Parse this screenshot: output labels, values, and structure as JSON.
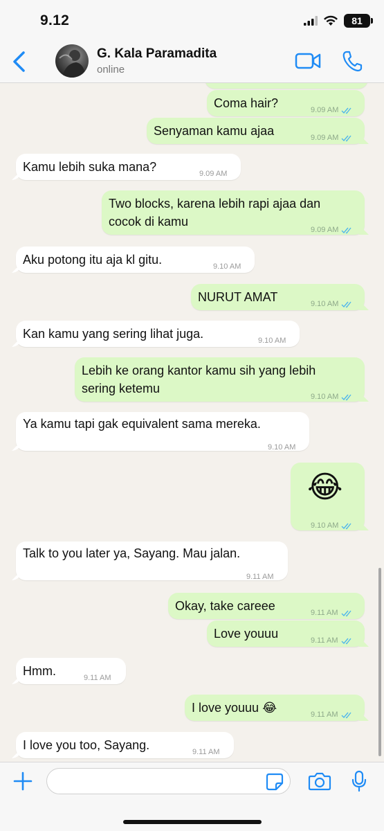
{
  "status_bar": {
    "time": "9.12",
    "battery": "81"
  },
  "header": {
    "contact_name": "G. Kala Paramadita",
    "contact_status": "online"
  },
  "messages": [
    {
      "dir": "out",
      "text": "Coma hair?",
      "time": "9.09 AM"
    },
    {
      "dir": "out",
      "text": "Senyaman kamu ajaa",
      "time": "9.09 AM"
    },
    {
      "dir": "in",
      "text": "Kamu lebih suka mana?",
      "time": "9.09 AM"
    },
    {
      "dir": "out",
      "text": "Two blocks, karena lebih rapi ajaa dan\ncocok di kamu",
      "time": "9.09 AM"
    },
    {
      "dir": "in",
      "text": "Aku potong itu aja kl gitu.",
      "time": "9.10 AM"
    },
    {
      "dir": "out",
      "text": "NURUT AMAT",
      "time": "9.10 AM"
    },
    {
      "dir": "in",
      "text": "Kan kamu yang sering lihat juga.",
      "time": "9.10 AM"
    },
    {
      "dir": "out",
      "text": "Lebih ke orang kantor kamu sih yang lebih\nsering ketemu",
      "time": "9.10 AM"
    },
    {
      "dir": "in",
      "text": "Ya kamu tapi gak equivalent sama mereka.",
      "time": "9.10 AM"
    },
    {
      "dir": "out",
      "text": "😂",
      "time": "9.10 AM"
    },
    {
      "dir": "in",
      "text": "Talk to you later ya, Sayang. Mau jalan.",
      "time": "9.11 AM"
    },
    {
      "dir": "out",
      "text": "Okay, take careee",
      "time": "9.11 AM"
    },
    {
      "dir": "out",
      "text": "Love youuu",
      "time": "9.11 AM"
    },
    {
      "dir": "in",
      "text": "Hmm.",
      "time": "9.11 AM"
    },
    {
      "dir": "out",
      "text": "I love youuu 😂",
      "time": "9.11 AM"
    },
    {
      "dir": "in",
      "text": "I love you too, Sayang.",
      "time": "9.11 AM"
    }
  ],
  "input": {
    "placeholder": ""
  },
  "icons": {
    "back": "chevron-left-icon",
    "video": "video-camera-icon",
    "phone": "phone-icon",
    "plus": "plus-icon",
    "sticker": "sticker-icon",
    "camera": "camera-icon",
    "mic": "microphone-icon"
  },
  "colors": {
    "accent": "#1f8bf5",
    "outgoing_bubble": "#dcf8c6",
    "incoming_bubble": "#ffffff",
    "read_ticks": "#4fb6ec"
  }
}
